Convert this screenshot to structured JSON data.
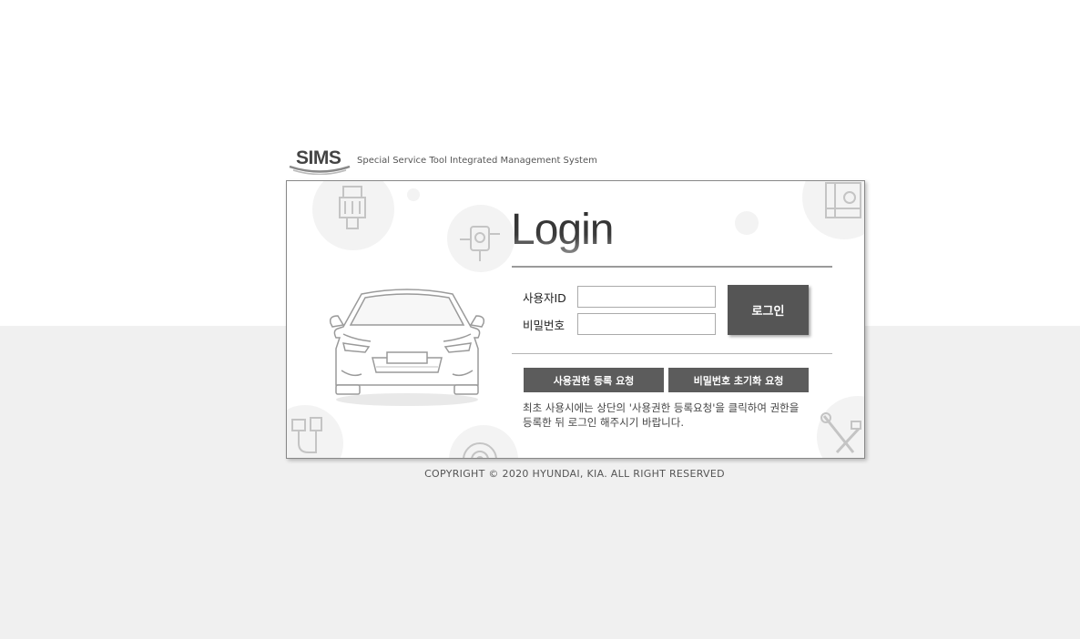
{
  "header": {
    "logo": "SIMS",
    "subtitle": "Special Service Tool Integrated Management System"
  },
  "login": {
    "title": "Login",
    "user_id_label": "사용자ID",
    "password_label": "비밀번호",
    "user_id_value": "",
    "password_value": "",
    "login_button": "로그인",
    "register_button": "사용권한 등록 요청",
    "reset_password_button": "비밀번호 초기화 요청",
    "note_line1": "최초 사용시에는 상단의 '사용권한 등록요청'을 클릭하여 권한을",
    "note_line2": "등록한 뒤 로그인 해주시기 바랍니다."
  },
  "footer": {
    "copyright": "COPYRIGHT © 2020 HYUNDAI, KIA. ALL RIGHT RESERVED"
  },
  "icons": [
    "sims-logo-swoosh-icon",
    "car-front-icon",
    "engine-part-icon",
    "sensor-part-icon",
    "cable-connector-icon",
    "gear-wheel-icon",
    "tool-wrench-icon",
    "machine-part-icon"
  ],
  "colors": {
    "button_dark": "#555555",
    "action_button": "#5c5c5c",
    "page_bottom": "#f0f0f0"
  }
}
